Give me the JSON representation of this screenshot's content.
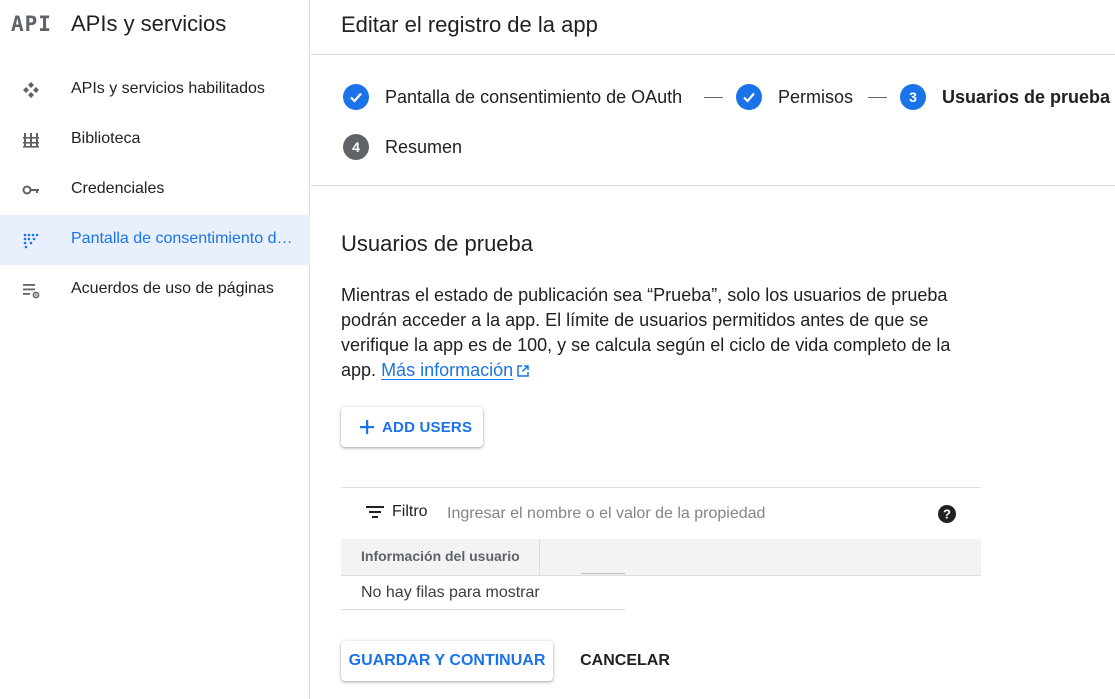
{
  "sidebar": {
    "logo": "API",
    "title": "APIs y servicios",
    "items": [
      {
        "label": "APIs y servicios habilitados",
        "icon": "dashboard-diamond-icon",
        "active": false
      },
      {
        "label": "Biblioteca",
        "icon": "library-icon",
        "active": false
      },
      {
        "label": "Credenciales",
        "icon": "key-icon",
        "active": false
      },
      {
        "label": "Pantalla de consentimiento de OAuth",
        "icon": "consent-dots-icon",
        "active": true
      },
      {
        "label": "Acuerdos de uso de páginas",
        "icon": "list-settings-icon",
        "active": false
      }
    ]
  },
  "header": {
    "title": "Editar el registro de la app"
  },
  "stepper": {
    "steps": [
      {
        "label": "Pantalla de consentimiento de OAuth",
        "state": "completed"
      },
      {
        "label": "Permisos",
        "state": "completed"
      },
      {
        "number": "3",
        "label": "Usuarios de prueba",
        "state": "current"
      },
      {
        "number": "4",
        "label": "Resumen",
        "state": "pending"
      }
    ]
  },
  "section": {
    "title": "Usuarios de prueba",
    "description": "Mientras el estado de publicación sea “Prueba”, solo los usuarios de prueba podrán acceder a la app. El límite de usuarios permitidos antes de que se verifique la app es de 100, y se calcula según el ciclo de vida completo de la app.",
    "link_text": "Más información"
  },
  "add_users_button": "ADD USERS",
  "filter": {
    "label": "Filtro",
    "placeholder": "Ingresar el nombre o el valor de la propiedad"
  },
  "table": {
    "columns": [
      "Información del usuario"
    ],
    "empty_text": "No hay filas para mostrar"
  },
  "actions": {
    "save": "GUARDAR Y CONTINUAR",
    "cancel": "CANCELAR"
  },
  "colors": {
    "accent": "#1a73e8",
    "active_bg": "#e8f0fe",
    "divider": "#dadce0"
  }
}
